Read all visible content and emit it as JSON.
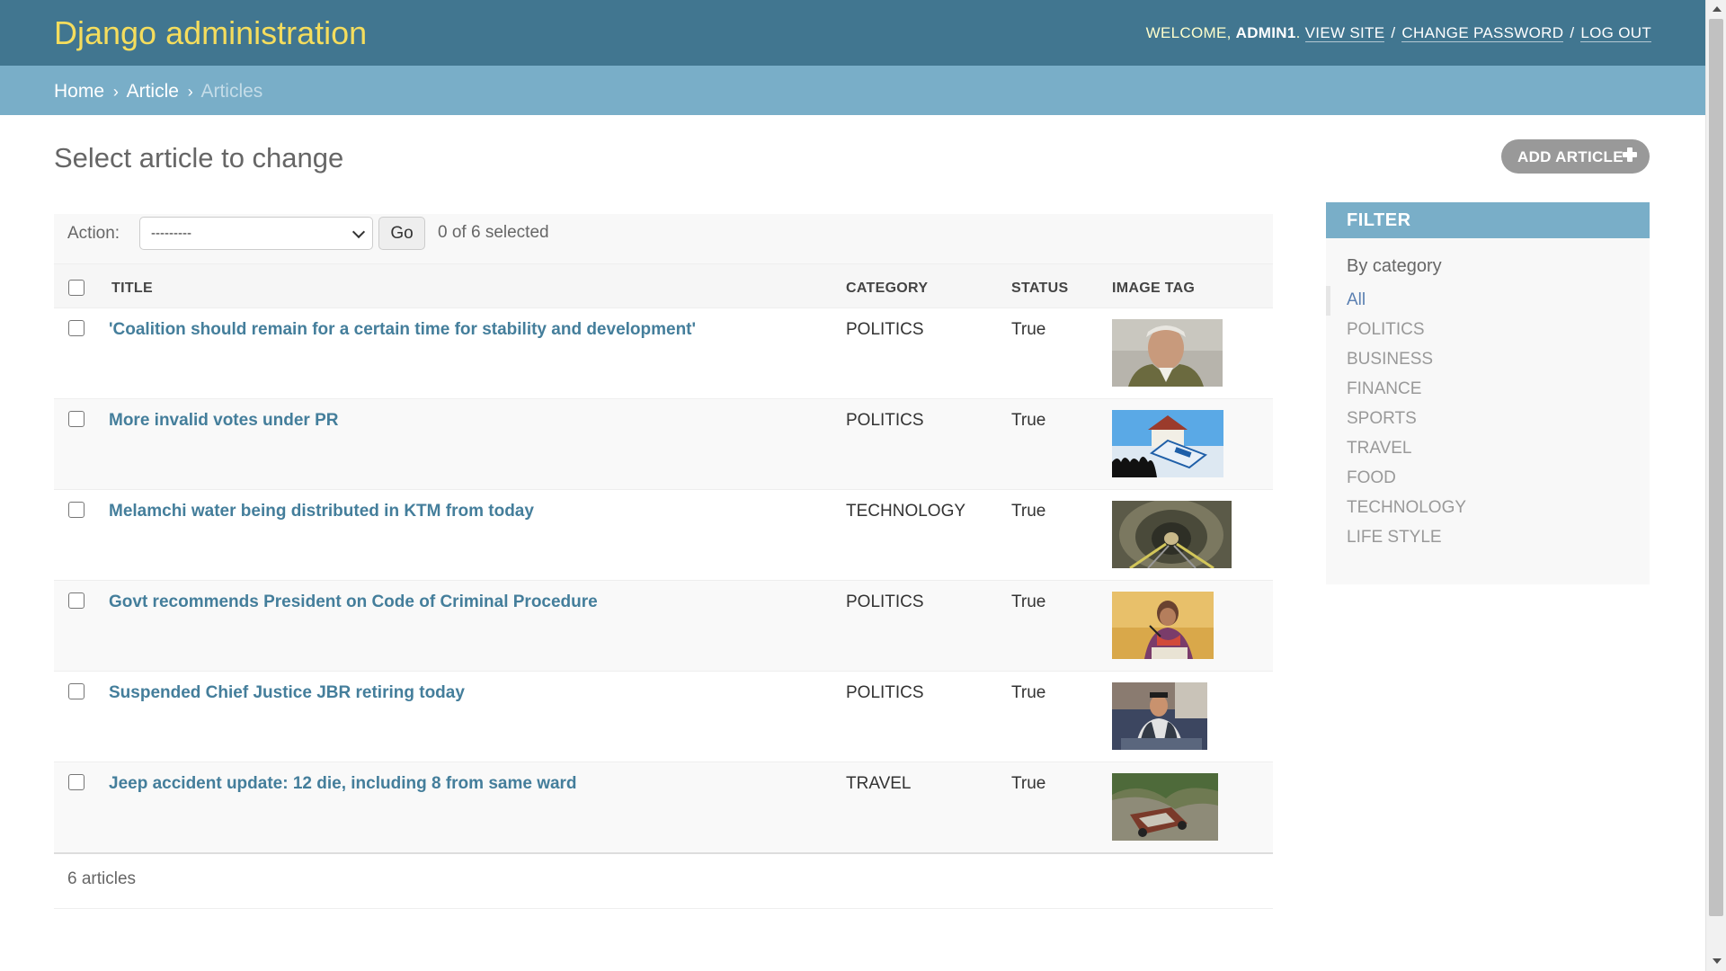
{
  "header": {
    "branding": "Django administration",
    "welcome": "WELCOME,",
    "username": "ADMIN1",
    "view_site": "VIEW SITE",
    "change_password": "CHANGE PASSWORD",
    "log_out": "LOG OUT"
  },
  "breadcrumbs": {
    "home": "Home",
    "app": "Article",
    "current": "Articles",
    "separator": "›"
  },
  "page": {
    "title": "Select article to change",
    "add_button": "ADD ARTICLE"
  },
  "actions": {
    "label": "Action:",
    "selected_value": "---------",
    "go": "Go",
    "selection_count": "0 of 6 selected"
  },
  "table": {
    "columns": {
      "title": "TITLE",
      "category": "CATEGORY",
      "status": "STATUS",
      "image_tag": "IMAGE TAG"
    },
    "rows": [
      {
        "title": "'Coalition should remain for a certain time for stability and development'",
        "category": "POLITICS",
        "status": "True",
        "image": "portrait-thumbnail"
      },
      {
        "title": "More invalid votes under PR",
        "category": "POLITICS",
        "status": "True",
        "image": "ballot-box-thumbnail"
      },
      {
        "title": "Melamchi water being distributed in KTM from today",
        "category": "TECHNOLOGY",
        "status": "True",
        "image": "tunnel-thumbnail"
      },
      {
        "title": "Govt recommends President on Code of Criminal Procedure",
        "category": "POLITICS",
        "status": "True",
        "image": "speaker-thumbnail"
      },
      {
        "title": "Suspended Chief Justice JBR retiring today",
        "category": "POLITICS",
        "status": "True",
        "image": "press-conference-thumbnail"
      },
      {
        "title": "Jeep accident update: 12 die, including 8 from same ward",
        "category": "TRAVEL",
        "status": "True",
        "image": "accident-thumbnail"
      }
    ]
  },
  "paginator": {
    "text": "6 articles"
  },
  "filter": {
    "heading": "FILTER",
    "group": "By category",
    "items": [
      "All",
      "POLITICS",
      "BUSINESS",
      "FINANCE",
      "SPORTS",
      "TRAVEL",
      "FOOD",
      "TECHNOLOGY",
      "LIFE STYLE"
    ],
    "selected": "All"
  },
  "colors": {
    "header_bg": "#417690",
    "branding": "#f5dd5d",
    "breadcrumb_bg": "#79aec8",
    "link": "#447e9b",
    "filter_selected": "#5b80b2"
  }
}
